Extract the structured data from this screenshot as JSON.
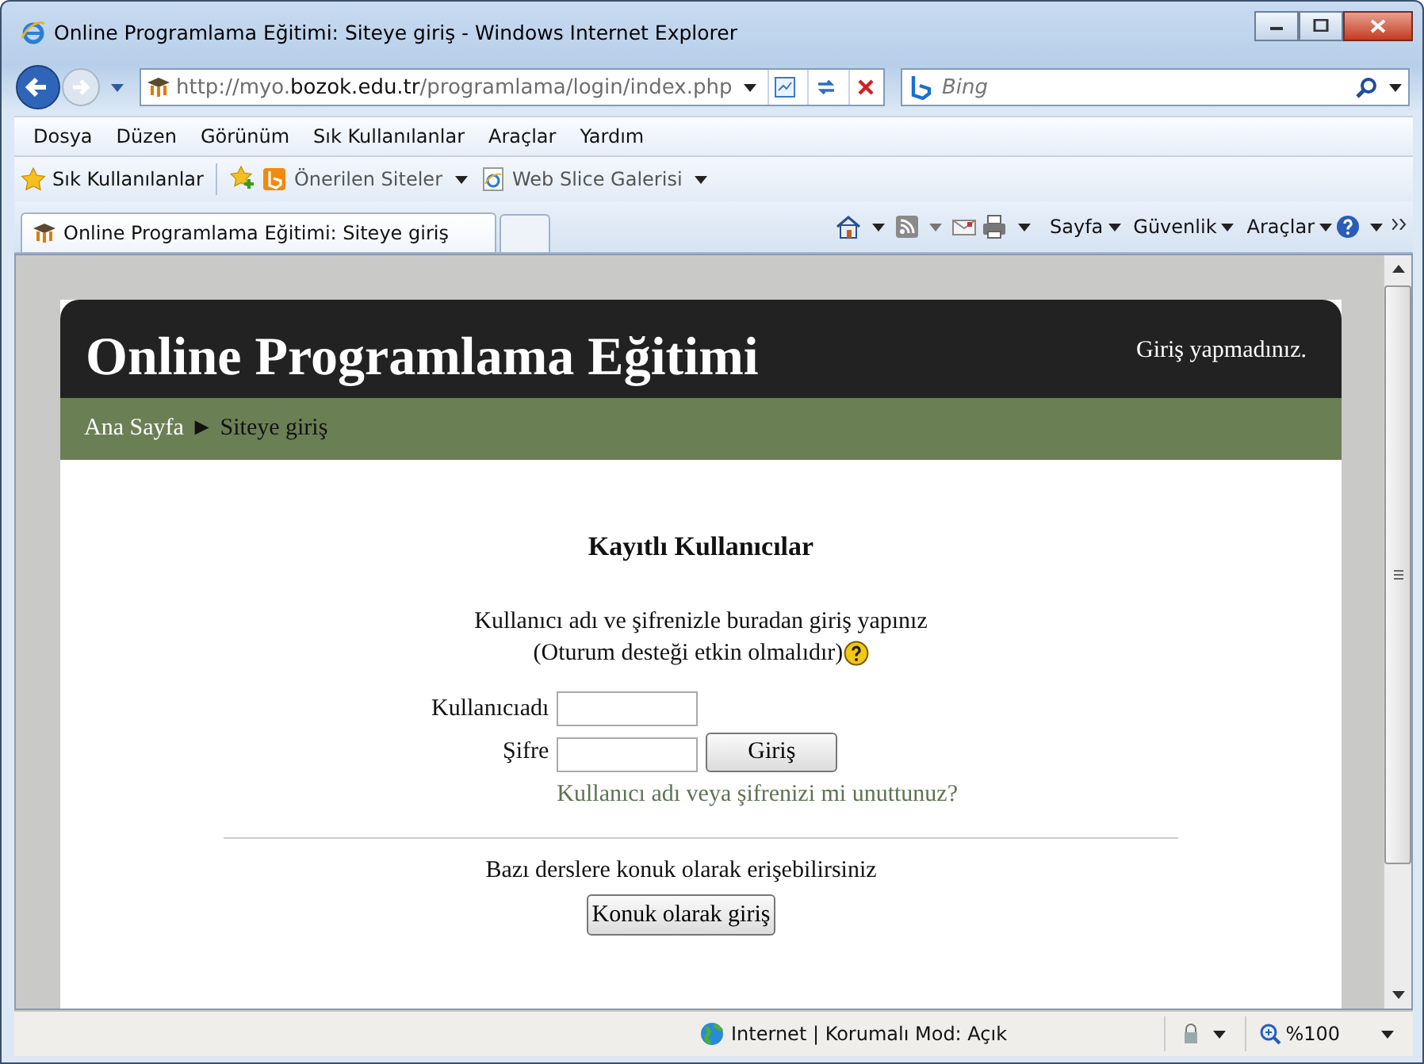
{
  "window": {
    "title": "Online Programlama Eğitimi: Siteye giriş - Windows Internet Explorer"
  },
  "address_bar": {
    "url": "http://myo.**bozok.edu.tr**/programlama/login/index.php"
  },
  "search": {
    "placeholder": "Bing"
  },
  "menu": [
    "Dosya",
    "Düzen",
    "Görünüm",
    "Sık Kullanılanlar",
    "Araçlar",
    "Yardım"
  ],
  "favorites_bar": [
    {
      "label": "Sık Kullanılanlar",
      "kind": "favorites"
    },
    {
      "label": "Önerilen Siteler",
      "kind": "suggested"
    },
    {
      "label": "Web Slice Galerisi",
      "kind": "webslice"
    }
  ],
  "tabs": [
    {
      "label": "Online Programlama Eğitimi: Siteye giriş",
      "selected": true
    }
  ],
  "command_bar": [
    "Sayfa",
    "Güvenlik",
    "Araçlar"
  ],
  "page": {
    "site_title": "Online Programlama Eğitimi",
    "login_info": "Giriş yapmadınız.",
    "breadcrumb": [
      {
        "label": "Ana Sayfa",
        "kind": "link"
      },
      {
        "label": "Siteye giriş",
        "kind": "current"
      }
    ],
    "breadcrumb_separator": "►",
    "heading": "Kayıtlı Kullanıcılar",
    "intro": [
      "Kullanıcı adı ve şifrenizle buradan giriş yapınız",
      "(Oturum desteği etkin olmalıdır)"
    ],
    "fields": [
      {
        "label": "Kullanıcıadı"
      },
      {
        "label": "Şifre"
      }
    ],
    "login_button": "Giriş",
    "forgot_link": "Kullanıcı adı veya şifrenizi mi unuttunuz?",
    "guest_text": "Bazı derslere konuk olarak erişebilirsiniz",
    "guest_button": "Konuk olarak giriş"
  },
  "status_bar": {
    "zone": "Internet | Korumalı Mod: Açık",
    "zoom": "%100"
  }
}
